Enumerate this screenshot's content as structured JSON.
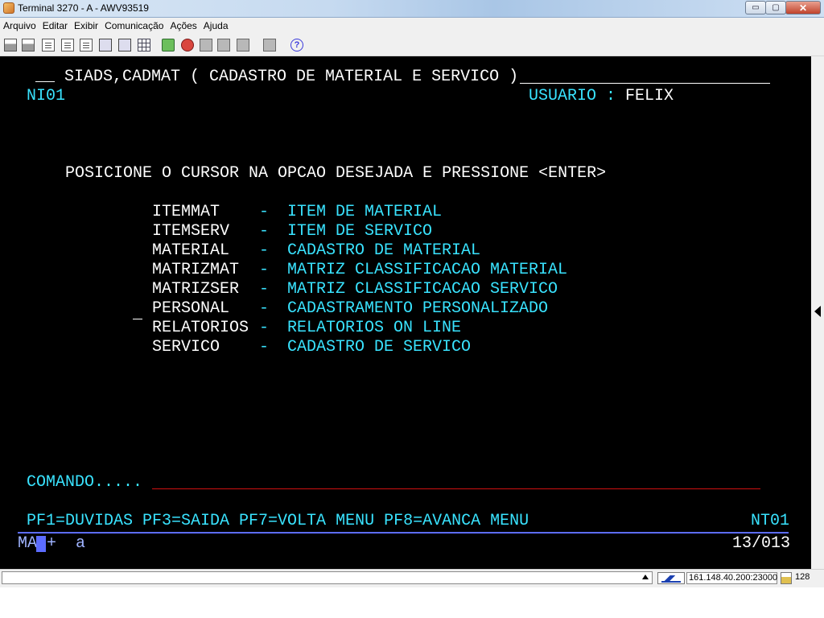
{
  "window": {
    "title": "Terminal 3270 - A - AWV93519",
    "minimize_glyph": "▭",
    "maximize_glyph": "▢",
    "close_glyph": "✕"
  },
  "menu": {
    "items": [
      "Arquivo",
      "Editar",
      "Exibir",
      "Comunicação",
      "Ações",
      "Ajuda"
    ]
  },
  "toolbar": {
    "icons": [
      "print-icon",
      "print-setup-icon",
      "paste-icon",
      "copy-icon",
      "paste-special-icon",
      "macro-icon",
      "grid-icon",
      "record-icon",
      "stop-icon",
      "play-icon",
      "transfer-icon",
      "settings-icon",
      "help-icon"
    ],
    "help_glyph": "?"
  },
  "terminal": {
    "header_prefix": "__",
    "header_title": "SIADS,CADMAT ( CADASTRO DE MATERIAL E SERVICO )",
    "screen_id": "NI01",
    "user_label": "USUARIO :",
    "user_value": "FELIX",
    "instruction": "POSICIONE O CURSOR NA OPCAO DESEJADA E PRESSIONE <ENTER>",
    "options": [
      {
        "code": "ITEMMAT",
        "dash": "-",
        "desc": "ITEM DE MATERIAL"
      },
      {
        "code": "ITEMSERV",
        "dash": "-",
        "desc": "ITEM DE SERVICO"
      },
      {
        "code": "MATERIAL",
        "dash": "-",
        "desc": "CADASTRO DE MATERIAL"
      },
      {
        "code": "MATRIZMAT",
        "dash": "-",
        "desc": "MATRIZ CLASSIFICACAO MATERIAL"
      },
      {
        "code": "MATRIZSER",
        "dash": "-",
        "desc": "MATRIZ CLASSIFICACAO SERVICO"
      },
      {
        "code": "PERSONAL",
        "dash": "-",
        "desc": "CADASTRAMENTO PERSONALIZADO"
      },
      {
        "code": "RELATORIOS",
        "dash": "-",
        "desc": "RELATORIOS ON LINE"
      },
      {
        "code": "SERVICO",
        "dash": "-",
        "desc": "CADASTRO DE SERVICO"
      }
    ],
    "command_label": "COMANDO.....",
    "pf_keys": "PF1=DUVIDAS PF3=SAIDA PF7=VOLTA MENU PF8=AVANCA MENU",
    "transaction_code": "NT01",
    "oia_mode": "MA",
    "oia_plus": "+",
    "oia_a": "a",
    "cursor_position": "13/013",
    "colors": {
      "background": "#000000",
      "field_text": "#ffffff",
      "protected_text": "#39e3ff",
      "oia": "#5c6cff",
      "command_underline": "#d01010"
    }
  },
  "statusbar": {
    "host": "161.148.40.200:23000",
    "bits": "128"
  }
}
